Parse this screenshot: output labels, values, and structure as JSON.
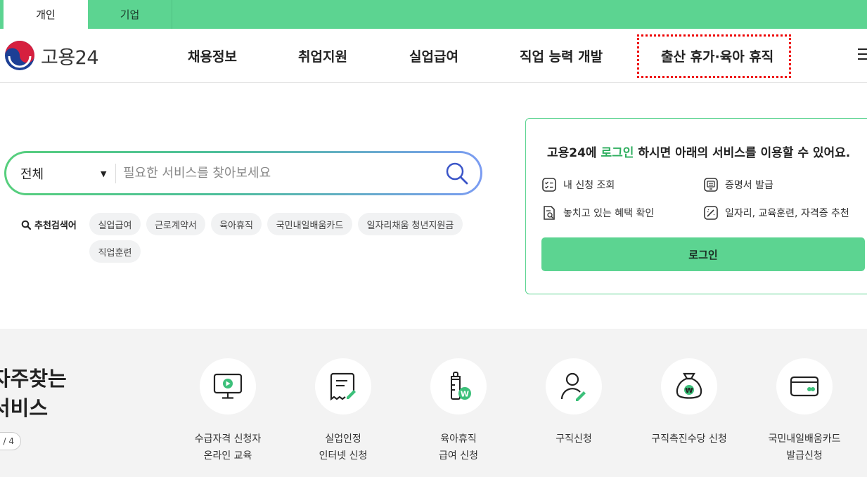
{
  "top_tabs": {
    "personal": "개인",
    "business": "기업"
  },
  "logo": {
    "text": "고용24"
  },
  "nav": {
    "items": [
      "채용정보",
      "취업지원",
      "실업급여",
      "직업 능력 개발",
      "출산 휴가·육아 휴직"
    ]
  },
  "search": {
    "category": "전체",
    "placeholder": "필요한 서비스를 찾아보세요"
  },
  "recommend": {
    "label": "추천검색어",
    "keywords": [
      "실업급여",
      "근로계약서",
      "육아휴직",
      "국민내일배움카드",
      "일자리채움 청년지원금",
      "직업훈련"
    ]
  },
  "login_panel": {
    "msg_prefix": "고용24에 ",
    "msg_link": "로그인",
    "msg_suffix": " 하시면 아래의 서비스를 이용할 수 있어요.",
    "services": [
      "내 신청 조회",
      "증명서 발급",
      "놓치고 있는 혜택 확인",
      "일자리, 교육훈련, 자격증 추천"
    ],
    "login_button": "로그인"
  },
  "faq": {
    "title_line1": "자주찾는",
    "title_line2": "서비스",
    "pager": "/ 4",
    "items": [
      {
        "line1": "수급자격 신청자",
        "line2": "온라인 교육",
        "icon": "monitor-play-icon"
      },
      {
        "line1": "실업인정",
        "line2": "인터넷 신청",
        "icon": "document-pen-icon"
      },
      {
        "line1": "육아휴직",
        "line2": "급여 신청",
        "icon": "baby-bottle-icon"
      },
      {
        "line1": "구직신청",
        "line2": "",
        "icon": "person-pen-icon"
      },
      {
        "line1": "구직촉진수당 신청",
        "line2": "",
        "icon": "money-bag-icon"
      },
      {
        "line1": "국민내일배움카드",
        "line2": "발급신청",
        "icon": "card-icon"
      }
    ]
  },
  "colors": {
    "brand_green": "#5cd491",
    "link_green": "#2fae5f",
    "highlight_red": "#e00000"
  }
}
